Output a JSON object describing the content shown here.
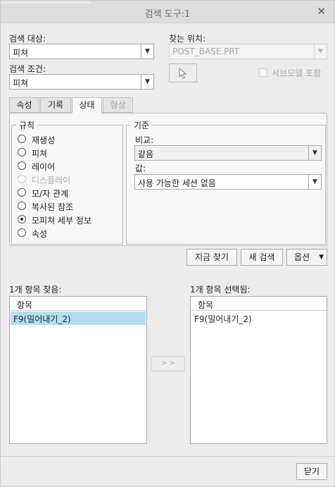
{
  "title": "검색 도구:1",
  "search_target": {
    "label": "검색 대상:",
    "value": "피쳐"
  },
  "search_condition": {
    "label": "검색 조건:",
    "value": "피쳐"
  },
  "look_in": {
    "label": "찾는 위치:",
    "value": "POST_BASE.PRT"
  },
  "include_submodels": "서브모델 포함",
  "tabs": [
    "속성",
    "기록",
    "상태",
    "형상"
  ],
  "rules": {
    "title": "규칙",
    "items": [
      "재생성",
      "피쳐",
      "레이어",
      "디스플레이",
      "모/자 관계",
      "복사된 참조",
      "모피쳐 세부 정보",
      "속성"
    ]
  },
  "criteria": {
    "title": "기준",
    "compare_label": "비교:",
    "compare_value": "같음",
    "value_label": "값:",
    "value_value": "사용 가능한 세션 없음"
  },
  "buttons": {
    "find_now": "지금 찾기",
    "new_search": "새 검색",
    "options": "옵션",
    "transfer": "> >",
    "close": "닫기"
  },
  "found": {
    "label": "1개 항목 찾음:",
    "header": "항목",
    "items": [
      "F9(밀어내기_2)"
    ]
  },
  "selected": {
    "label": "1개 항목 선택됨:",
    "header": "항목",
    "items": [
      "F9(밀어내기_2)"
    ]
  }
}
